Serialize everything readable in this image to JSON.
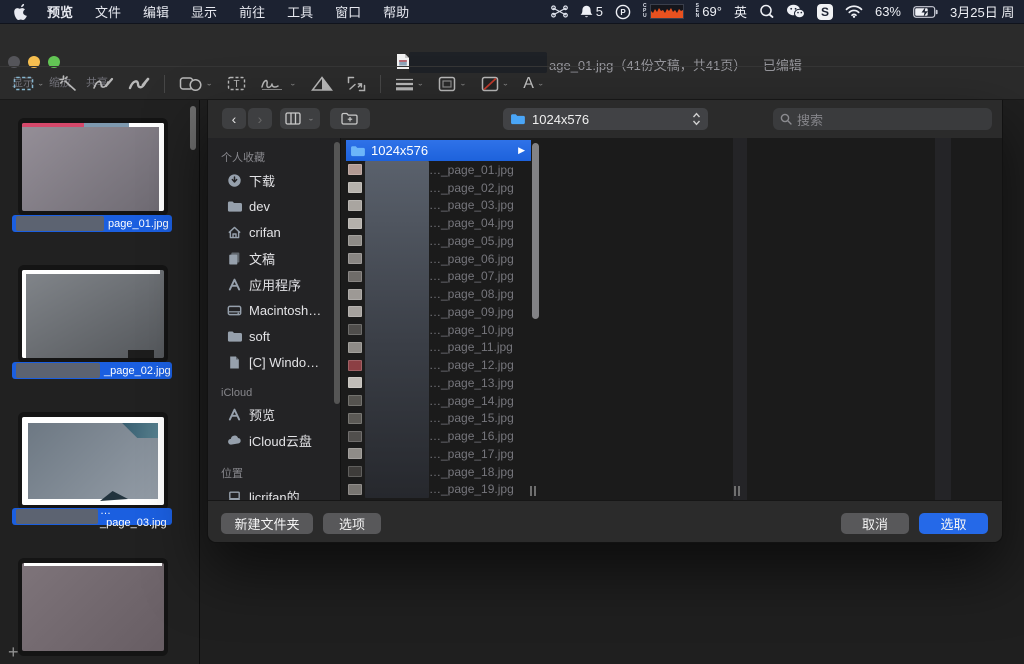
{
  "menubar": {
    "app_menu": "预览",
    "menus": [
      "文件",
      "编辑",
      "显示",
      "前往",
      "工具",
      "窗口",
      "帮助"
    ],
    "status": {
      "notification_count": "5",
      "cpu_letters": [
        "C",
        "P",
        "U"
      ],
      "sensor_letters": [
        "S",
        "E",
        "N"
      ],
      "temperature": "69°",
      "input_source": "英",
      "s_app_label": "S",
      "battery_percent": "63%",
      "date": "3月25日",
      "date_partial": "周"
    }
  },
  "window": {
    "title": "age_01.jpg（41份文稿，共41页）— 已编辑",
    "toolbar_labels": {
      "show": "显示",
      "zoom": "缩放",
      "share": "共享"
    },
    "markup_text_style": "A"
  },
  "preview_sidebar": {
    "thumbnails": [
      {
        "label": "page_01.jpg"
      },
      {
        "label": "_page_02.jpg"
      },
      {
        "label": "…_page_03.jpg"
      },
      {
        "label": ""
      }
    ],
    "add_button": "+"
  },
  "dialog": {
    "path_popup_value": "1024x576",
    "search_placeholder": "搜索",
    "sidebar": {
      "favorites_header": "个人收藏",
      "favorites": [
        {
          "icon": "#icon-download",
          "label": "下载"
        },
        {
          "icon": "#icon-folder",
          "label": "dev"
        },
        {
          "icon": "#icon-home",
          "label": "crifan"
        },
        {
          "icon": "#icon-docs",
          "label": "文稿"
        },
        {
          "icon": "#icon-apps",
          "label": "应用程序"
        },
        {
          "icon": "#icon-disk",
          "label": "Macintosh…"
        },
        {
          "icon": "#icon-folder",
          "label": "soft"
        },
        {
          "icon": "#icon-page",
          "label": "[C] Windo…"
        }
      ],
      "icloud_header": "iCloud",
      "icloud": [
        {
          "icon": "#icon-apps",
          "label": "预览"
        },
        {
          "icon": "#icon-cloud",
          "label": "iCloud云盘"
        }
      ],
      "locations_header": "位置",
      "locations": [
        {
          "icon": "#icon-laptop",
          "label": "licrifan的…"
        }
      ]
    },
    "browser": {
      "selected_folder": "1024x576",
      "files": [
        {
          "name": "…_page_01.jpg",
          "thumb": "#b29a93"
        },
        {
          "name": "…_page_02.jpg",
          "thumb": "#b6b2ad"
        },
        {
          "name": "…_page_03.jpg",
          "thumb": "#a9a5a0"
        },
        {
          "name": "…_page_04.jpg",
          "thumb": "#b4b0ab"
        },
        {
          "name": "…_page_05.jpg",
          "thumb": "#8e8b87"
        },
        {
          "name": "…_page_06.jpg",
          "thumb": "#898683"
        },
        {
          "name": "…_page_07.jpg",
          "thumb": "#6f6c69"
        },
        {
          "name": "…_page_08.jpg",
          "thumb": "#9d9995"
        },
        {
          "name": "…_page_09.jpg",
          "thumb": "#a6a29e"
        },
        {
          "name": "…_page_10.jpg",
          "thumb": "#4f4d4b"
        },
        {
          "name": "…_page_11.jpg",
          "thumb": "#8e8b87"
        },
        {
          "name": "…_page_12.jpg",
          "thumb": "#8c3f44"
        },
        {
          "name": "…_page_13.jpg",
          "thumb": "#c1bdb8"
        },
        {
          "name": "…_page_14.jpg",
          "thumb": "#55534f"
        },
        {
          "name": "…_page_15.jpg",
          "thumb": "#5b5955"
        },
        {
          "name": "…_page_16.jpg",
          "thumb": "#514f4d"
        },
        {
          "name": "…_page_17.jpg",
          "thumb": "#8f8c88"
        },
        {
          "name": "…_page_18.jpg",
          "thumb": "#3e3c3a"
        },
        {
          "name": "…_page_19.jpg",
          "thumb": "#787571"
        }
      ]
    },
    "footer": {
      "new_folder": "新建文件夹",
      "options": "选项",
      "cancel": "取消",
      "choose": "选取"
    }
  },
  "colors": {
    "menubar_bg": "#1c2231",
    "accent_blue": "#2569e8",
    "selection_blue": "#1d62dc",
    "thumb_label_blue": "#1b5fe0",
    "redaction_gray": "#5c6371",
    "cpu_graph_orange": "#e8511f",
    "folder_blue": "#4aa6f8"
  }
}
